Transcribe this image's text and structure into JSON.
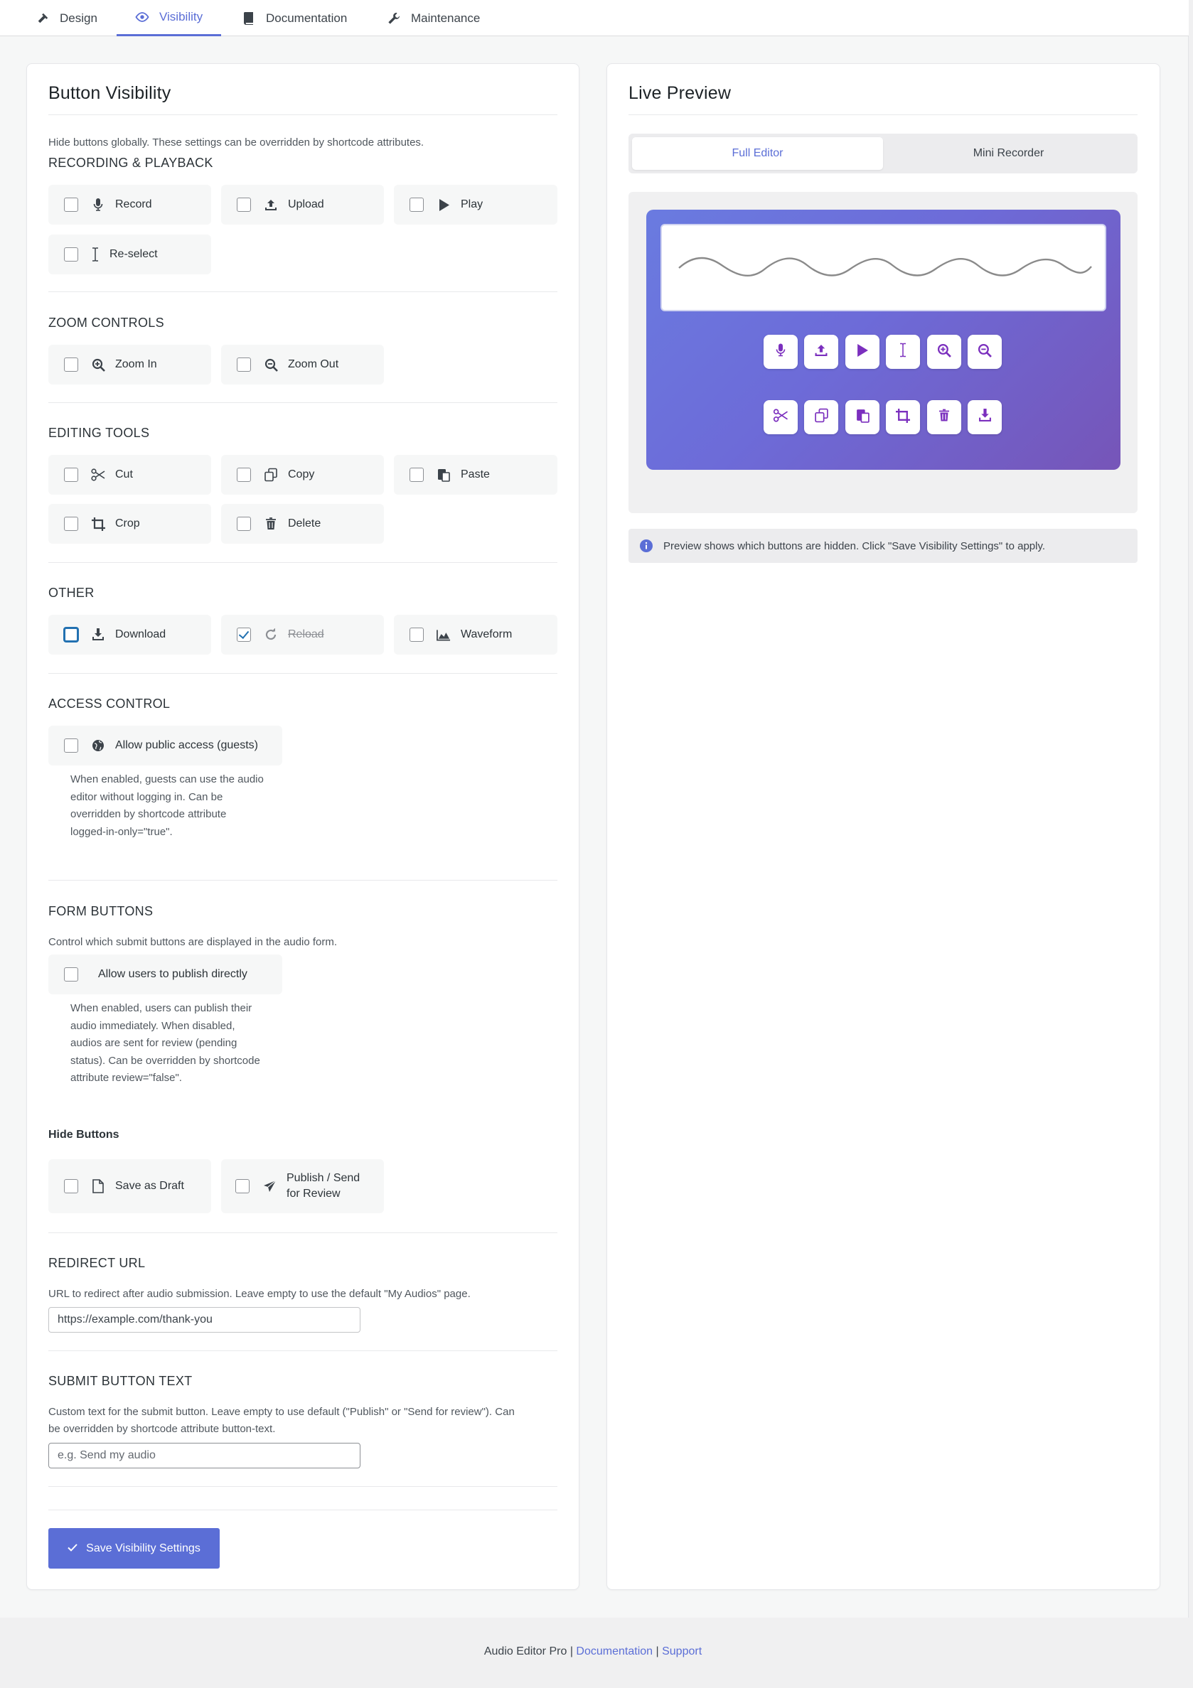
{
  "tabs": [
    {
      "label": "Design",
      "icon": "hammer-icon"
    },
    {
      "label": "Visibility",
      "icon": "eye-icon",
      "active": true
    },
    {
      "label": "Documentation",
      "icon": "book-icon"
    },
    {
      "label": "Maintenance",
      "icon": "wrench-icon"
    }
  ],
  "left_card": {
    "title": "Button Visibility",
    "intro": "Hide buttons globally. These settings can be overridden by shortcode attributes.",
    "recording": {
      "heading": "RECORDING & PLAYBACK",
      "options": [
        {
          "label": "Record",
          "icon": "microphone-icon",
          "checked": false
        },
        {
          "label": "Upload",
          "icon": "upload-icon",
          "checked": false
        },
        {
          "label": "Play",
          "icon": "play-icon",
          "checked": false
        },
        {
          "label": "Re-select",
          "icon": "text-cursor-icon",
          "checked": false
        }
      ]
    },
    "zoom": {
      "heading": "ZOOM CONTROLS",
      "options": [
        {
          "label": "Zoom In",
          "icon": "zoom-in-icon",
          "checked": false
        },
        {
          "label": "Zoom Out",
          "icon": "zoom-out-icon",
          "checked": false
        }
      ]
    },
    "editing": {
      "heading": "EDITING TOOLS",
      "options": [
        {
          "label": "Cut",
          "icon": "scissors-icon",
          "checked": false
        },
        {
          "label": "Copy",
          "icon": "copy-icon",
          "checked": false
        },
        {
          "label": "Paste",
          "icon": "paste-icon",
          "checked": false
        },
        {
          "label": "Crop",
          "icon": "crop-icon",
          "checked": false
        },
        {
          "label": "Delete",
          "icon": "trash-icon",
          "checked": false
        }
      ]
    },
    "other": {
      "heading": "OTHER",
      "options": [
        {
          "label": "Download",
          "icon": "download-icon",
          "checked": false
        },
        {
          "label": "Reload",
          "icon": "reload-icon",
          "checked": true
        },
        {
          "label": "Waveform",
          "icon": "area-chart-icon",
          "checked": false
        }
      ]
    },
    "access": {
      "heading": "ACCESS CONTROL",
      "option": {
        "label": "Allow public access (guests)",
        "icon": "globe-icon",
        "checked": false
      },
      "hint_lines": [
        "When enabled, guests can use the audio",
        "editor without logging in. Can be",
        "overridden by shortcode attribute",
        "logged-in-only=\"true\"."
      ]
    },
    "form_buttons": {
      "heading": "FORM BUTTONS",
      "intro": "Control which submit buttons are displayed in the audio form.",
      "option": {
        "label": "Allow users to publish directly",
        "checked": false
      },
      "hint_lines": [
        "When enabled, users can publish their",
        "audio immediately. When disabled,",
        "audios are sent for review (pending",
        "status). Can be overridden by shortcode",
        "attribute review=\"false\"."
      ],
      "hide_heading": "Hide Buttons",
      "hide_options": [
        {
          "label": "Save as Draft",
          "icon": "file-icon",
          "checked": false
        },
        {
          "label_line1": "Publish / Send",
          "label_line2": "for Review",
          "icon": "send-icon",
          "checked": false
        }
      ]
    },
    "redirect": {
      "heading": "REDIRECT URL",
      "intro": "URL to redirect after audio submission. Leave empty to use the default \"My Audios\" page.",
      "value": "https://example.com/thank-you"
    },
    "submit_text": {
      "heading": "SUBMIT BUTTON TEXT",
      "intro_line1": "Custom text for the submit button. Leave empty to use default (\"Publish\" or \"Send for review\"). Can",
      "intro_line2": "be overridden by shortcode attribute button-text.",
      "placeholder": "e.g. Send my audio"
    },
    "save_label": "Save Visibility Settings"
  },
  "preview": {
    "title": "Live Preview",
    "modes": [
      "Full Editor",
      "Mini Recorder"
    ],
    "active_mode": "Full Editor",
    "row1_icons": [
      "microphone-icon",
      "upload-icon",
      "play-icon",
      "text-cursor-icon",
      "zoom-in-icon",
      "zoom-out-icon"
    ],
    "row2_icons": [
      "scissors-icon",
      "copy-icon",
      "paste-icon",
      "crop-icon",
      "trash-icon",
      "download-icon"
    ],
    "notice": "Preview shows which buttons are hidden. Click \"Save Visibility Settings\" to apply."
  },
  "footer": {
    "product": "Audio Editor Pro",
    "sep": "|",
    "docs": "Documentation",
    "support": "Support"
  },
  "colors": {
    "accent": "#5b6ed6",
    "gradient_start": "#6a7be0",
    "gradient_end": "#7655b8",
    "preview_icon": "#7b2fbe"
  }
}
